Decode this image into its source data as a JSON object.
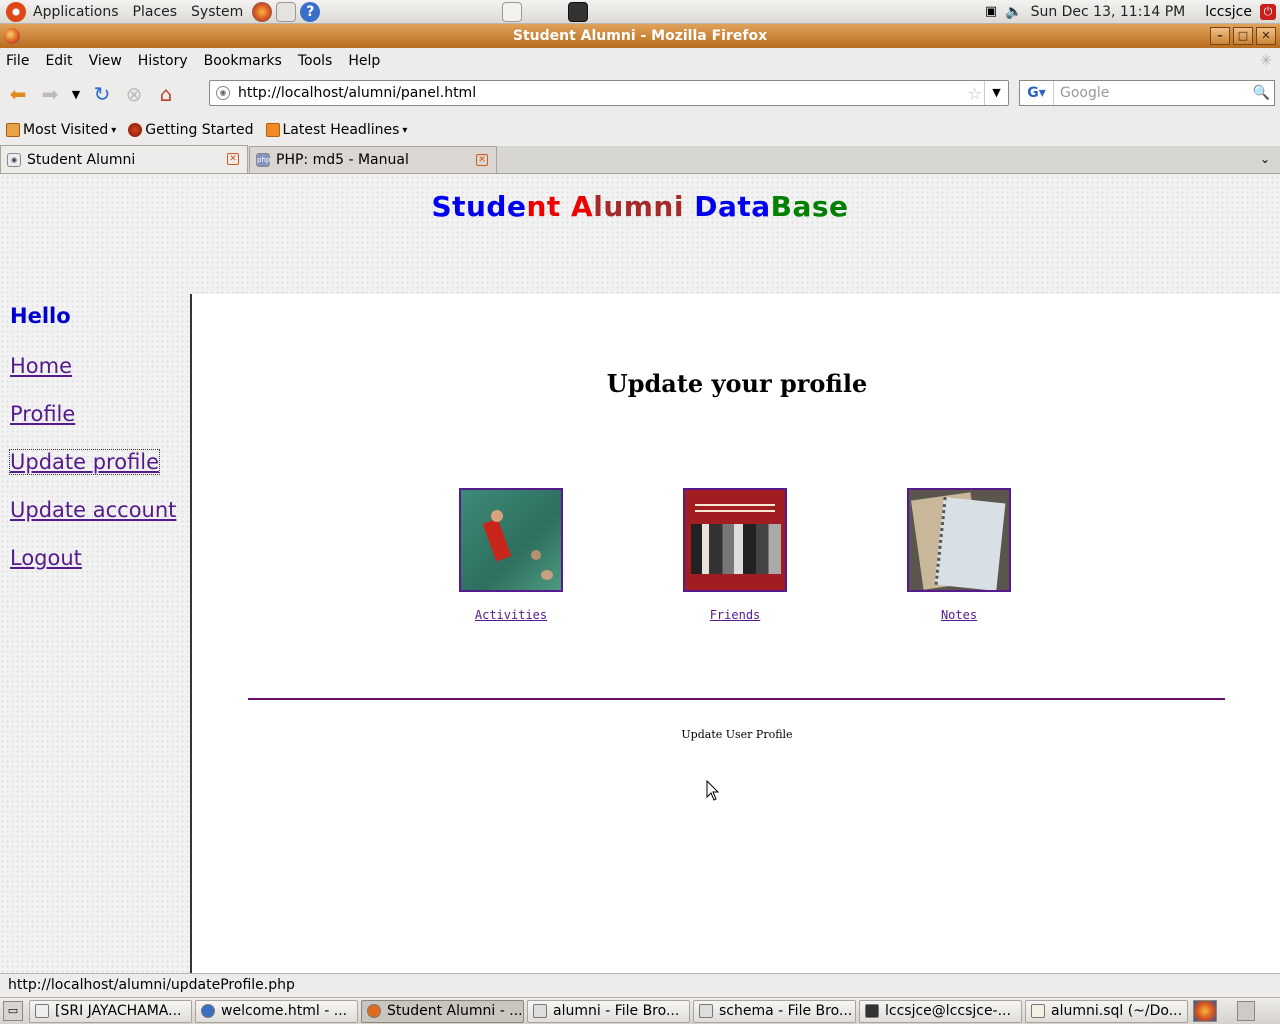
{
  "gnome_panel": {
    "menus": [
      "Applications",
      "Places",
      "System"
    ],
    "clock": "Sun Dec 13, 11:14 PM",
    "user": "lccsjce"
  },
  "window": {
    "title": "Student Alumni - Mozilla Firefox"
  },
  "menubar": [
    "File",
    "Edit",
    "View",
    "History",
    "Bookmarks",
    "Tools",
    "Help"
  ],
  "navigation": {
    "url": "http://localhost/alumni/panel.html",
    "search_placeholder": "Google"
  },
  "bookmarks": [
    "Most Visited",
    "Getting Started",
    "Latest Headlines"
  ],
  "tabs": [
    {
      "label": "Student Alumni",
      "active": true
    },
    {
      "label": "PHP: md5 - Manual",
      "active": false
    }
  ],
  "page": {
    "title_parts": [
      "Stude",
      "nt ",
      "A",
      "lumni ",
      "Data",
      "Base"
    ],
    "hello": "Hello",
    "sidebar_links": [
      "Home",
      "Profile",
      "Update profile",
      "Update account",
      "Logout"
    ],
    "heading": "Update your profile",
    "tiles": [
      {
        "label": "Activities"
      },
      {
        "label": "Friends"
      },
      {
        "label": "Notes"
      }
    ],
    "footer": "Update User Profile"
  },
  "status_text": "http://localhost/alumni/updateProfile.php",
  "taskbar": [
    {
      "label": "[SRI JAYACHAMA..."
    },
    {
      "label": "welcome.html - ..."
    },
    {
      "label": "Student Alumni - ...",
      "active": true
    },
    {
      "label": "alumni - File Bro..."
    },
    {
      "label": "schema - File Bro..."
    },
    {
      "label": "lccsjce@lccsjce-..."
    },
    {
      "label": "alumni.sql (~/Do..."
    }
  ]
}
